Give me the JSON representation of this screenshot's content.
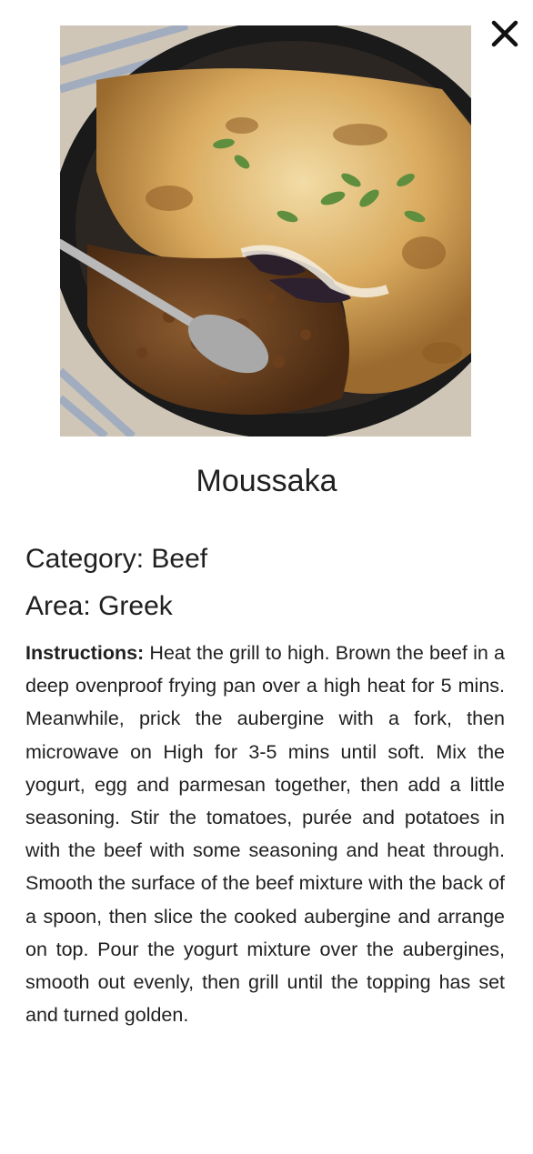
{
  "meal": {
    "title": "Moussaka",
    "category_label": "Category:",
    "category": "Beef",
    "area_label": "Area:",
    "area": "Greek",
    "instructions_label": "Instructions:",
    "instructions": "Heat the grill to high. Brown the beef in a deep ovenproof frying pan over a high heat for 5 mins. Meanwhile, prick the aubergine with a fork, then microwave on High for 3-5 mins until soft. Mix the yogurt, egg and parmesan together, then add a little seasoning. Stir the tomatoes, purée and potatoes in with the beef with some seasoning and heat through. Smooth the surface of the beef mixture with the back of a spoon, then slice the cooked aubergine and arrange on top. Pour the yogurt mixture over the aubergines, smooth out evenly, then grill until the topping has set and turned golden."
  },
  "icons": {
    "close": "close-icon"
  },
  "colors": {
    "text": "#202020",
    "background": "#ffffff"
  }
}
